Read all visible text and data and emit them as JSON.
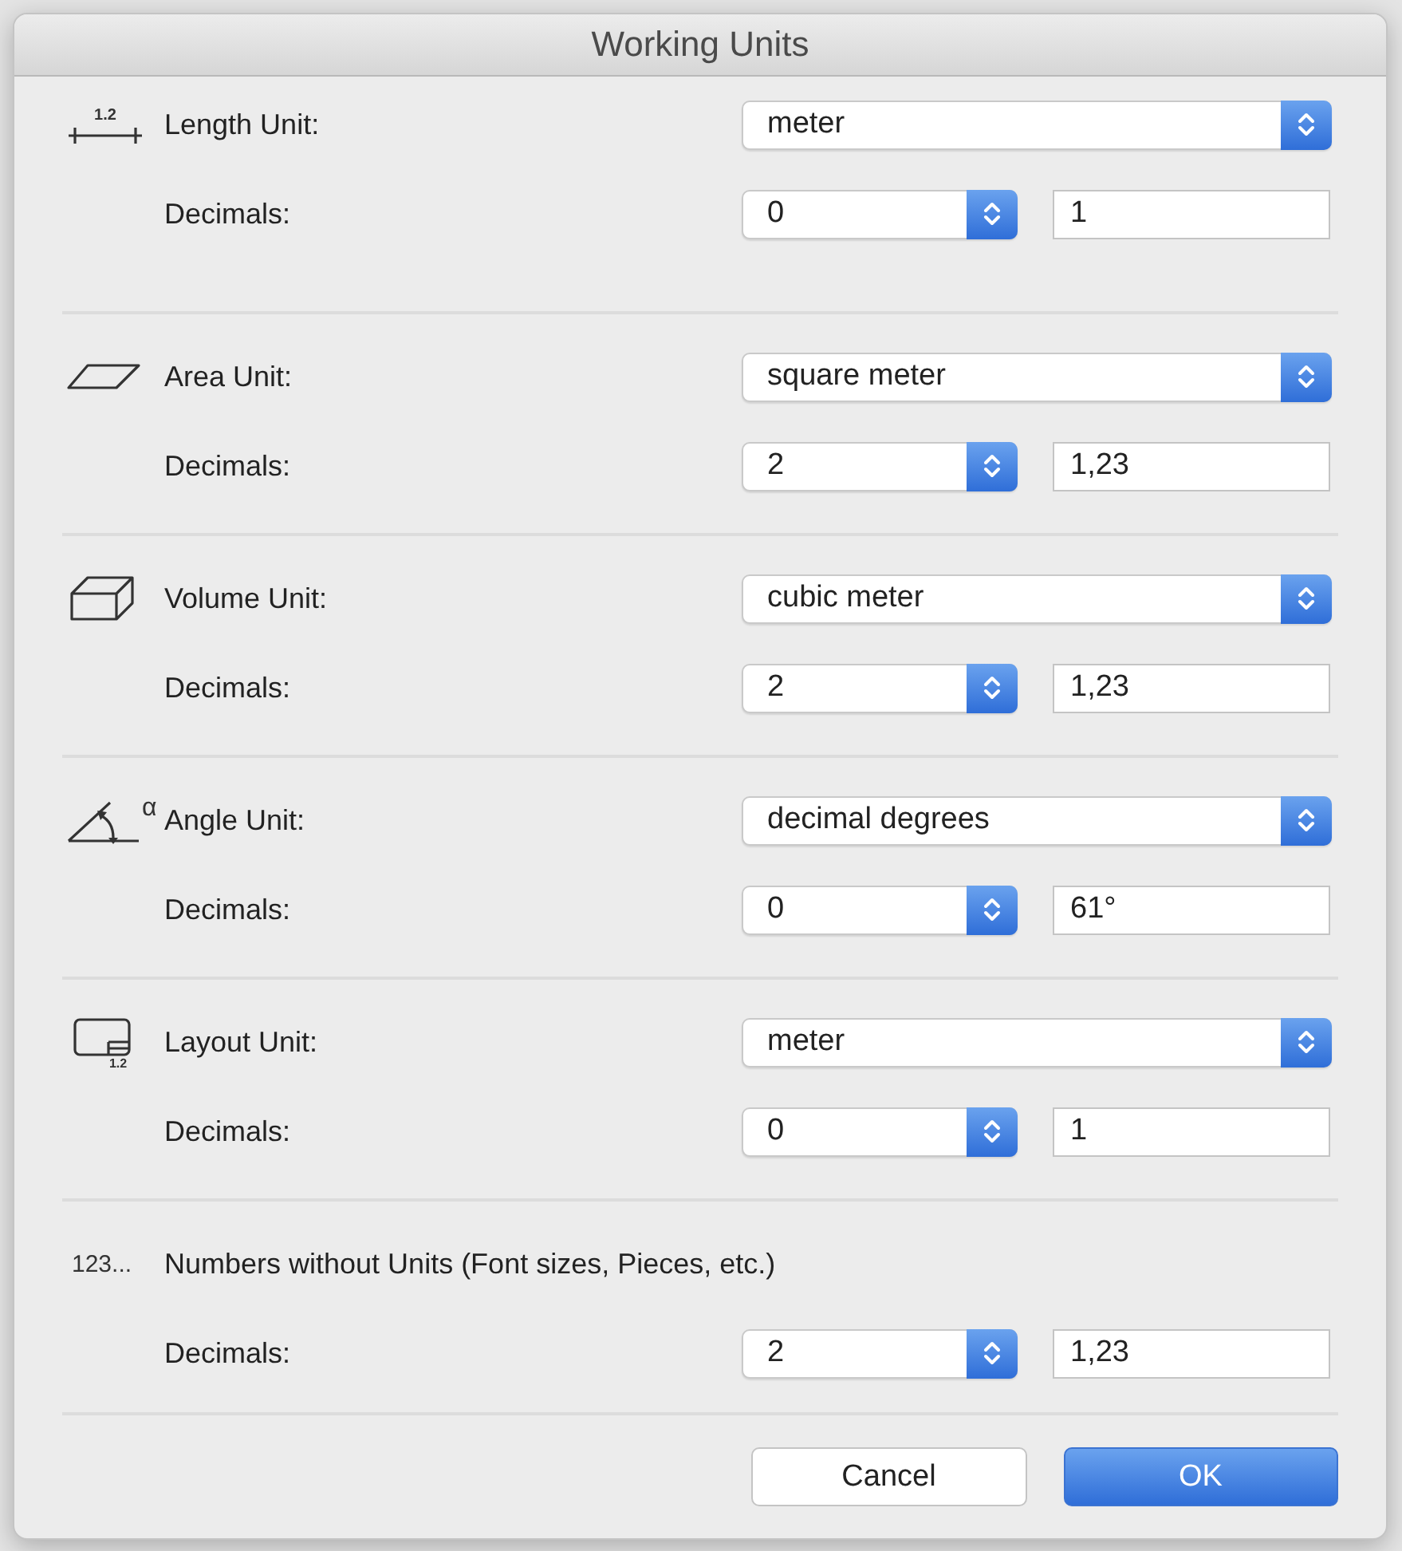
{
  "window": {
    "title": "Working Units"
  },
  "sections": [
    {
      "kind": "ruler",
      "icon_text": "1.2",
      "label": "Length Unit:",
      "unit": "meter",
      "decimals_label": "Decimals:",
      "decimals": "0",
      "sample": "1"
    },
    {
      "kind": "parallelogram",
      "label": "Area Unit:",
      "unit": "square meter",
      "decimals_label": "Decimals:",
      "decimals": "2",
      "sample": "1,23"
    },
    {
      "kind": "box",
      "label": "Volume Unit:",
      "unit": "cubic meter",
      "decimals_label": "Decimals:",
      "decimals": "2",
      "sample": "1,23"
    },
    {
      "kind": "angle",
      "icon_text": "α",
      "label": "Angle Unit:",
      "unit": "decimal degrees",
      "decimals_label": "Decimals:",
      "decimals": "0",
      "sample": "61°"
    },
    {
      "kind": "layout",
      "icon_text": "1.2",
      "label": "Layout Unit:",
      "unit": "meter",
      "decimals_label": "Decimals:",
      "decimals": "0",
      "sample": "1"
    },
    {
      "kind": "text",
      "icon_text": "123...",
      "label": "Numbers without Units (Font sizes, Pieces, etc.)",
      "decimals_label": "Decimals:",
      "decimals": "2",
      "sample": "1,23"
    }
  ],
  "buttons": [
    {
      "label": "Cancel",
      "kind": "default"
    },
    {
      "label": "OK",
      "kind": "primary"
    }
  ]
}
